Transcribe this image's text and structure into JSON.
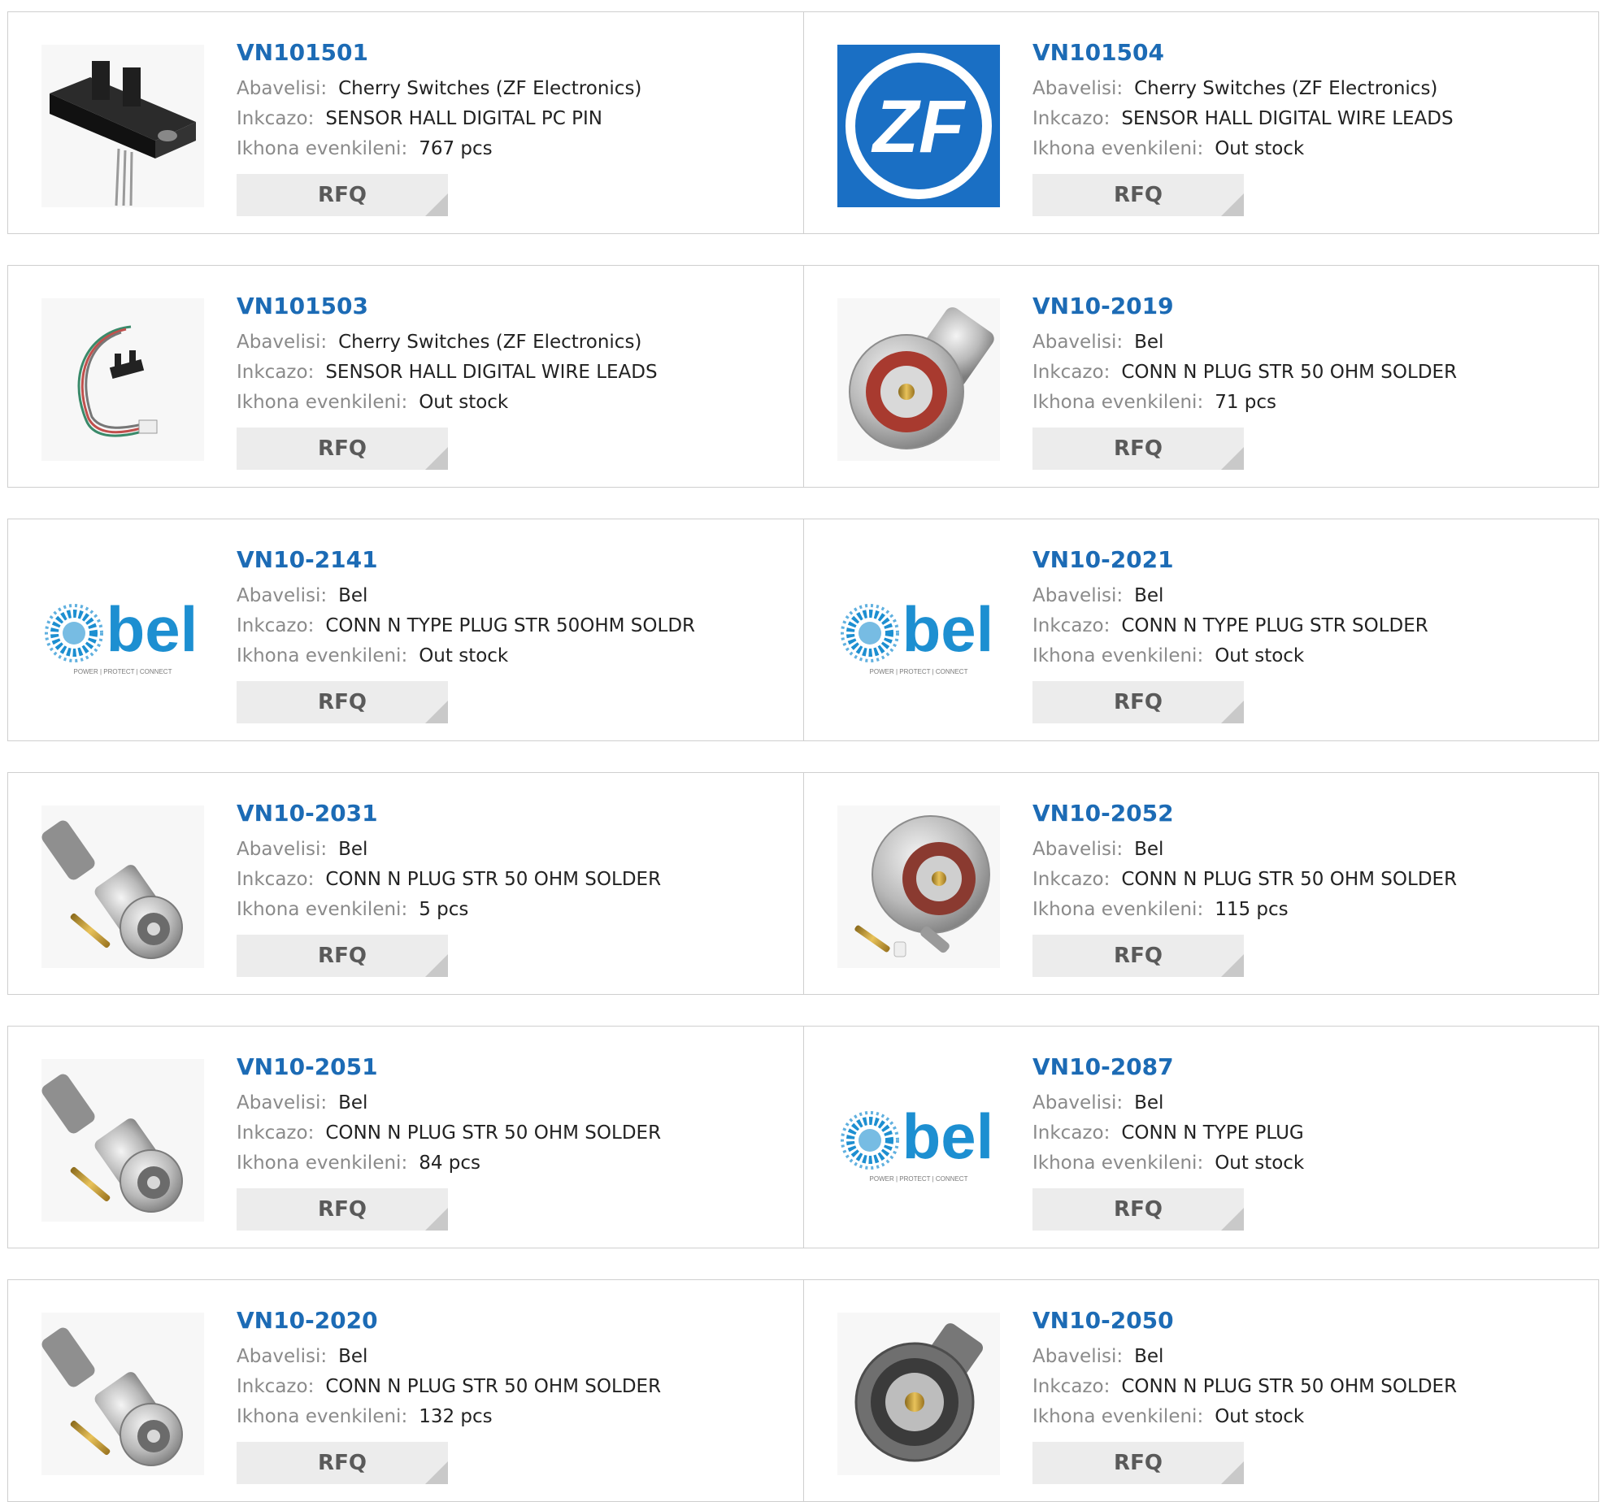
{
  "labels": {
    "manufacturer": "Abavelisi:",
    "description": "Inkcazo:",
    "stock": "Ikhona evenkileni:",
    "rfq": "RFQ"
  },
  "products": [
    {
      "part": "VN101501",
      "manufacturer": "Cherry Switches (ZF Electronics)",
      "description": "SENSOR HALL DIGITAL PC PIN",
      "stock": "767 pcs",
      "image": "sensor-pc-pin"
    },
    {
      "part": "VN101504",
      "manufacturer": "Cherry Switches (ZF Electronics)",
      "description": "SENSOR HALL DIGITAL WIRE LEADS",
      "stock": "Out stock",
      "image": "zf-logo"
    },
    {
      "part": "VN101503",
      "manufacturer": "Cherry Switches (ZF Electronics)",
      "description": "SENSOR HALL DIGITAL WIRE LEADS",
      "stock": "Out stock",
      "image": "sensor-wire-leads"
    },
    {
      "part": "VN10-2019",
      "manufacturer": "Bel",
      "description": "CONN N PLUG STR 50 OHM SOLDER",
      "stock": "71 pcs",
      "image": "n-plug-front"
    },
    {
      "part": "VN10-2141",
      "manufacturer": "Bel",
      "description": "CONN N TYPE PLUG STR 50OHM SOLDR",
      "stock": "Out stock",
      "image": "bel-logo"
    },
    {
      "part": "VN10-2021",
      "manufacturer": "Bel",
      "description": "CONN N TYPE PLUG STR SOLDER",
      "stock": "Out stock",
      "image": "bel-logo"
    },
    {
      "part": "VN10-2031",
      "manufacturer": "Bel",
      "description": "CONN N PLUG STR 50 OHM SOLDER",
      "stock": "5 pcs",
      "image": "n-plug-kit"
    },
    {
      "part": "VN10-2052",
      "manufacturer": "Bel",
      "description": "CONN N PLUG STR 50 OHM SOLDER",
      "stock": "115 pcs",
      "image": "n-plug-kit-large"
    },
    {
      "part": "VN10-2051",
      "manufacturer": "Bel",
      "description": "CONN N PLUG STR 50 OHM SOLDER",
      "stock": "84 pcs",
      "image": "n-plug-kit"
    },
    {
      "part": "VN10-2087",
      "manufacturer": "Bel",
      "description": "CONN N TYPE PLUG",
      "stock": "Out stock",
      "image": "bel-logo"
    },
    {
      "part": "VN10-2020",
      "manufacturer": "Bel",
      "description": "CONN N PLUG STR 50 OHM SOLDER",
      "stock": "132 pcs",
      "image": "n-plug-kit"
    },
    {
      "part": "VN10-2050",
      "manufacturer": "Bel",
      "description": "CONN N PLUG STR 50 OHM SOLDER",
      "stock": "Out stock",
      "image": "n-plug-dark"
    }
  ],
  "logo_text": {
    "zf": "ZF",
    "bel": "bel",
    "bel_tagline": "POWER | PROTECT | CONNECT"
  },
  "colors": {
    "part_link": "#1c6bb5",
    "label_gray": "#8a8a8a",
    "rfq_bg": "#ececec",
    "border": "#cfcfcf",
    "zf_blue": "#1a6fc4",
    "bel_blue": "#1d8fd1"
  }
}
